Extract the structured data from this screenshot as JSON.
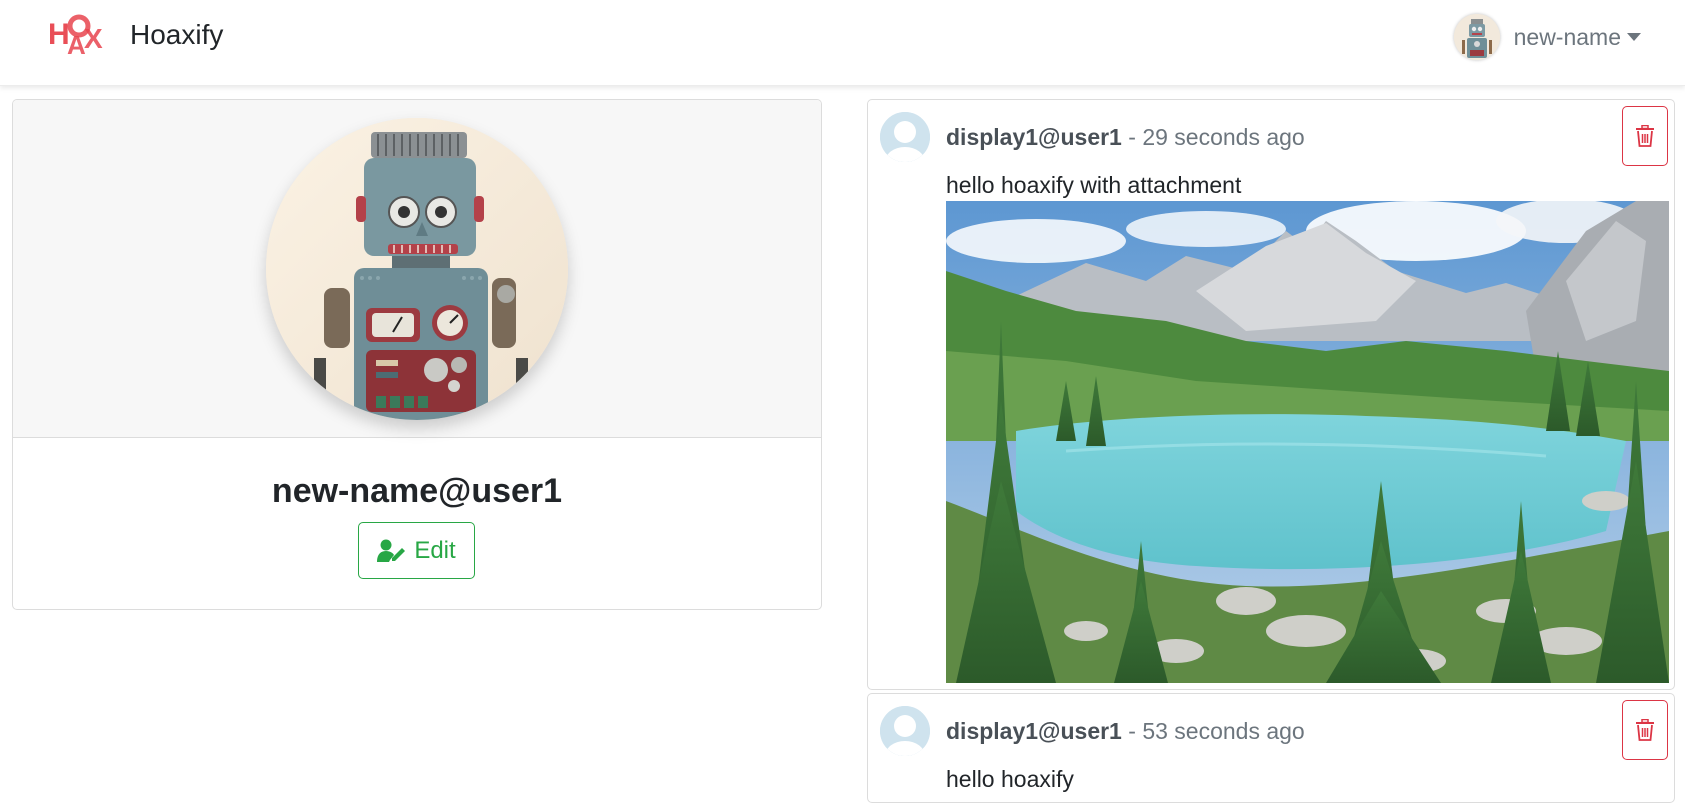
{
  "navbar": {
    "brand_text": "Hoaxify",
    "logo_text": "HOAX",
    "username": "new-name"
  },
  "profile": {
    "full_name": "new-name@user1",
    "edit_label": "Edit"
  },
  "posts": [
    {
      "author": "display1@user1",
      "separator": "-",
      "time": "29 seconds ago",
      "content": "hello hoaxify with attachment",
      "has_attachment": true
    },
    {
      "author": "display1@user1",
      "separator": "-",
      "time": "53 seconds ago",
      "content": "hello hoaxify",
      "has_attachment": false
    }
  ],
  "colors": {
    "brand": "#e8454f",
    "edit": "#28a745",
    "delete": "#dc3545",
    "muted": "#6c757d"
  },
  "icons": {
    "edit": "user-edit-icon",
    "delete": "trash-icon"
  }
}
